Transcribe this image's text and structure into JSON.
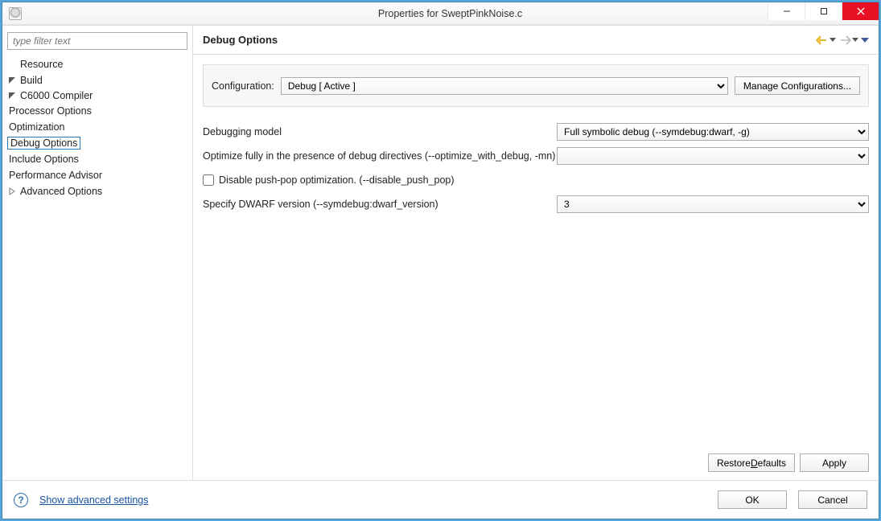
{
  "window": {
    "title": "Properties for SweptPinkNoise.c"
  },
  "sidebar": {
    "filter_placeholder": "type filter text",
    "tree": {
      "resource": "Resource",
      "build": "Build",
      "compiler": "C6000 Compiler",
      "items": [
        "Processor Options",
        "Optimization",
        "Debug Options",
        "Include Options",
        "Performance Advisor",
        "Advanced Options"
      ]
    }
  },
  "main": {
    "title": "Debug Options",
    "config": {
      "label": "Configuration:",
      "selected": "Debug  [ Active ]",
      "manage_btn": "Manage Configurations..."
    },
    "options": {
      "debugging_model": {
        "label": "Debugging model",
        "value": "Full symbolic debug (--symdebug:dwarf, -g)"
      },
      "optimize_with_debug": {
        "label": "Optimize fully in the presence of debug directives (--optimize_with_debug, -mn)",
        "value": ""
      },
      "disable_push_pop": {
        "label": "Disable push-pop optimization. (--disable_push_pop)",
        "checked": false
      },
      "dwarf_version": {
        "label": "Specify DWARF version (--symdebug:dwarf_version)",
        "value": "3"
      }
    },
    "restore_btn": "Restore Defaults",
    "apply_btn": "Apply"
  },
  "footer": {
    "advanced_link": "Show advanced settings",
    "ok_btn": "OK",
    "cancel_btn": "Cancel"
  }
}
